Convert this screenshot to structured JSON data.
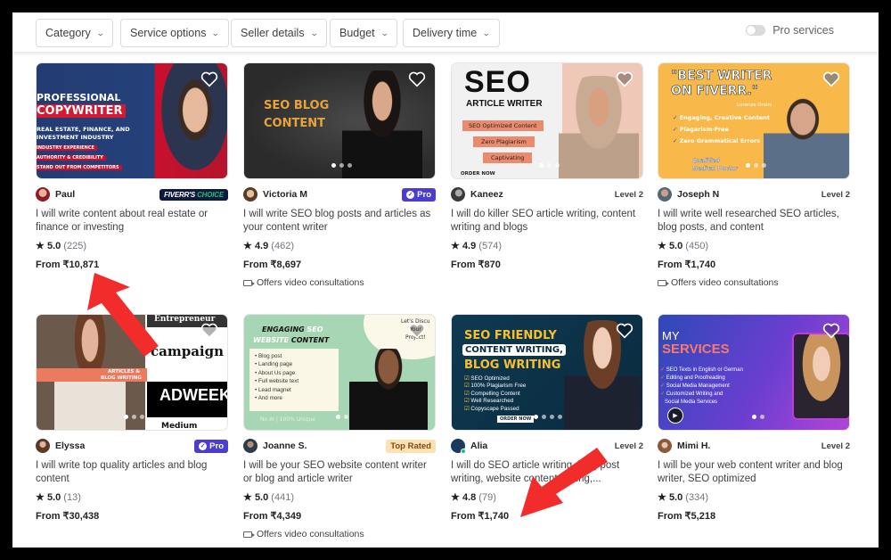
{
  "filters": [
    {
      "label": "Category"
    },
    {
      "label": "Service options"
    },
    {
      "label": "Seller details"
    },
    {
      "label": "Budget"
    },
    {
      "label": "Delivery time"
    }
  ],
  "pro_services": {
    "label": "Pro services",
    "enabled": false
  },
  "colors": {
    "pro_badge": "#4a3dcf",
    "fiverrs_choice_bg": "#0e1a3b",
    "fiverr_green": "#1dbf73",
    "top_rated_bg": "#ffe0b3",
    "annotation_arrow": "#f22b2b"
  },
  "gigs": [
    {
      "seller": "Paul",
      "badge_type": "fiverrs-choice",
      "badge": {
        "a": "FIVERR'S",
        "b": "CHOICE"
      },
      "title": "I will write content about real estate or finance or investing",
      "rating": "5.0",
      "reviews": "(225)",
      "price": "From ₹10,871",
      "video": "",
      "thumb": {
        "l1": "PROFESSIONAL",
        "l2": "COPYWRITER",
        "l3": "REAL ESTATE, FINANCE, AND",
        "l4": "INVESTMENT INDUSTRY",
        "b1": "INDUSTRY EXPERIENCE",
        "b2": "AUTHORITY & CREDIBILITY",
        "b3": "STAND OUT FROM COMPETITORS"
      }
    },
    {
      "seller": "Victoria M",
      "badge_type": "pro",
      "badge": {
        "a": "Pro"
      },
      "title": "I will write SEO blog posts and articles as your content writer",
      "rating": "4.9",
      "reviews": "(462)",
      "price": "From ₹8,697",
      "video": "Offers video consultations",
      "thumb": {
        "l1": "SEO BLOG",
        "l2": "CONTENT"
      }
    },
    {
      "seller": "Kaneez",
      "badge_type": "level",
      "badge": {
        "a": "Level 2"
      },
      "title": "I will do killer SEO article writing, content writing and blogs",
      "rating": "4.9",
      "reviews": "(574)",
      "price": "From ₹870",
      "video": "",
      "thumb": {
        "l1": "SEO",
        "l2": "ARTICLE WRITER",
        "b1": "SEO Optimized Content",
        "b2": "Zero Plagiarism",
        "b3": "Captivating",
        "cta": "ORDER NOW"
      }
    },
    {
      "seller": "Joseph N",
      "badge_type": "level",
      "badge": {
        "a": "Level 2"
      },
      "title": "I will write well researched SEO articles, blog posts, and content",
      "rating": "5.0",
      "reviews": "(450)",
      "price": "From ₹1,740",
      "video": "Offers video consultations",
      "thumb": {
        "l1": "\"BEST WRITER",
        "l2": "ON FIVERR.\"",
        "sig": "Lorenzo Orsini",
        "b1": "Engaging, Creative Content",
        "b2": "Plagarism-Free",
        "b3": "Zero Grammatical Errors",
        "b4": "Qualified",
        "b5": "Medical Doctor"
      }
    },
    {
      "seller": "Elyssa",
      "badge_type": "pro",
      "badge": {
        "a": "Pro"
      },
      "title": "I will write top quality articles and blog content",
      "rating": "5.0",
      "reviews": "(13)",
      "price": "From ₹30,438",
      "video": "",
      "thumb": {
        "l1": "Entrepreneur",
        "l2": "campaign",
        "l3": "ARTICLES &",
        "l4": "BLOG WRITING",
        "l5": "ADWEEK",
        "l6": "Medium"
      }
    },
    {
      "seller": "Joanne S.",
      "badge_type": "top-rated",
      "badge": {
        "a": "Top Rated"
      },
      "title": "I will be your SEO website content writer or blog and article writer",
      "rating": "5.0",
      "reviews": "(441)",
      "price": "From ₹4,349",
      "video": "Offers video consultations",
      "thumb": {
        "l1a": "ENGAGING",
        "l1b": " SEO",
        "l2a": "WEBSITE",
        "l2b": " CONTENT",
        "items": [
          "Blog post",
          "Landing page",
          "About Us page",
          "Full website text",
          "Lead magnet",
          "And more"
        ],
        "foot": "No AI | 100% Unique",
        "side1": "Let's Discu",
        "side2": "Your",
        "side3": "Project!"
      }
    },
    {
      "seller": "Alia",
      "badge_type": "level",
      "badge": {
        "a": "Level 2"
      },
      "title": "I will do SEO article writing, blog post writing, website content writing,...",
      "rating": "4.8",
      "reviews": "(79)",
      "price": "From ₹1,740",
      "video": "",
      "thumb": {
        "l1": "SEO FRIENDLY",
        "l2": "CONTENT WRITING,",
        "l3": "BLOG WRITING",
        "items": [
          "SEO Optimized",
          "100% Plagiarism Free",
          "Compelling Content",
          "Well Researched",
          "Copyscape Passed"
        ],
        "cta": "ORDER NOW"
      }
    },
    {
      "seller": "Mimi H.",
      "badge_type": "level",
      "badge": {
        "a": "Level 2"
      },
      "title": "I will be your web content writer and blog writer, SEO optimized",
      "rating": "5.0",
      "reviews": "(334)",
      "price": "From ₹5,218",
      "video": "",
      "thumb": {
        "l1": "MY",
        "l2": "SERVICES",
        "items": [
          "SEO Texts in English or German",
          "Editing and Proofreading",
          "Social Media Management",
          "Customized Writing and",
          "Social Media Services"
        ]
      }
    }
  ],
  "annotations": [
    {
      "type": "arrow",
      "points_to": "From ₹10,871"
    },
    {
      "type": "arrow",
      "points_to": "From ₹1,740"
    }
  ]
}
